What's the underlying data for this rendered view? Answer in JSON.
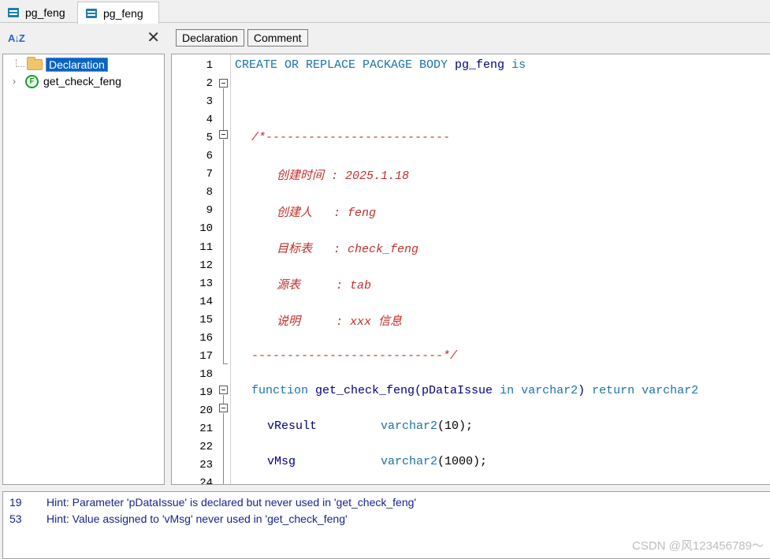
{
  "tabs": [
    {
      "label": "pg_feng"
    },
    {
      "label": "pg_feng"
    }
  ],
  "left_toolbar": {
    "sort_label": "A↓Z",
    "close_label": "✕"
  },
  "toolbar": {
    "declaration_label": "Declaration",
    "comment_label": "Comment"
  },
  "tree": {
    "items": [
      {
        "label": "Declaration",
        "selected": true
      },
      {
        "label": "get_check_feng",
        "icon_text": "F"
      }
    ]
  },
  "editor": {
    "line_numbers": [
      "1",
      "2",
      "3",
      "4",
      "5",
      "6",
      "7",
      "8",
      "9",
      "10",
      "11",
      "12",
      "13",
      "14",
      "15",
      "16",
      "17",
      "18",
      "19",
      "20",
      "21",
      "22",
      "23",
      "24"
    ],
    "lines": {
      "l1": {
        "k1": "CREATE OR REPLACE PACKAGE BODY ",
        "id": "pg_feng",
        "k2": " is"
      },
      "l5": "/*--------------------------",
      "l7": "创建时间 : 2025.1.18",
      "l9": "创建人   : feng",
      "l11": "目标表   : check_feng",
      "l13": "源表     : tab",
      "l15": "说明     : xxx 信息",
      "l17": "---------------------------*/",
      "l19": {
        "k1": "function ",
        "id": "get_check_feng",
        "p1": "(pDataIssue ",
        "k2": "in varchar2",
        "p2": ") ",
        "k3": "return varchar2"
      },
      "l21": {
        "id": "vResult",
        "k": "varchar2",
        "n": "(10);"
      },
      "l23": {
        "id": "vMsg",
        "k": "varchar2",
        "n": "(1000);"
      }
    }
  },
  "messages": [
    {
      "line": "19",
      "text": "Hint: Parameter 'pDataIssue' is declared but never used in 'get_check_feng'"
    },
    {
      "line": "53",
      "text": "Hint: Value assigned to 'vMsg' never used in 'get_check_feng'"
    }
  ],
  "watermark": "CSDN @风123456789～",
  "colors": {
    "keyword": "#1a73a8",
    "comment": "#c0302b",
    "identifier": "#000080",
    "selection": "#0a64c2",
    "function_icon": "#1c9a33"
  }
}
